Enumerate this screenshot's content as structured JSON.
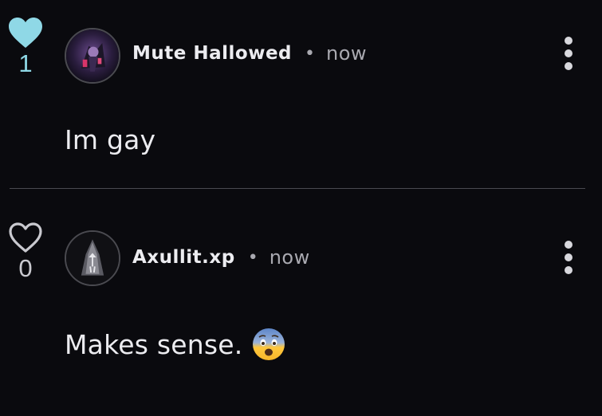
{
  "colors": {
    "background": "#0a0a0e",
    "liked_heart": "#8fd8e6",
    "text_primary": "#ececf0",
    "text_secondary": "#a9a9b0",
    "divider": "#4a4a50"
  },
  "comments": [
    {
      "like_count": "1",
      "liked": true,
      "heart_icon": "heart-filled-icon",
      "author": "Mute Hallowed",
      "separator": "•",
      "timestamp": "now",
      "text": "Im gay",
      "more_icon": "more-vertical-icon"
    },
    {
      "like_count": "0",
      "liked": false,
      "heart_icon": "heart-outline-icon",
      "author": "Axullit.xp",
      "separator": "•",
      "timestamp": "now",
      "text": "Makes sense.",
      "emoji": "😨",
      "emoji_icon": "fearful-face-emoji-icon",
      "more_icon": "more-vertical-icon"
    }
  ]
}
